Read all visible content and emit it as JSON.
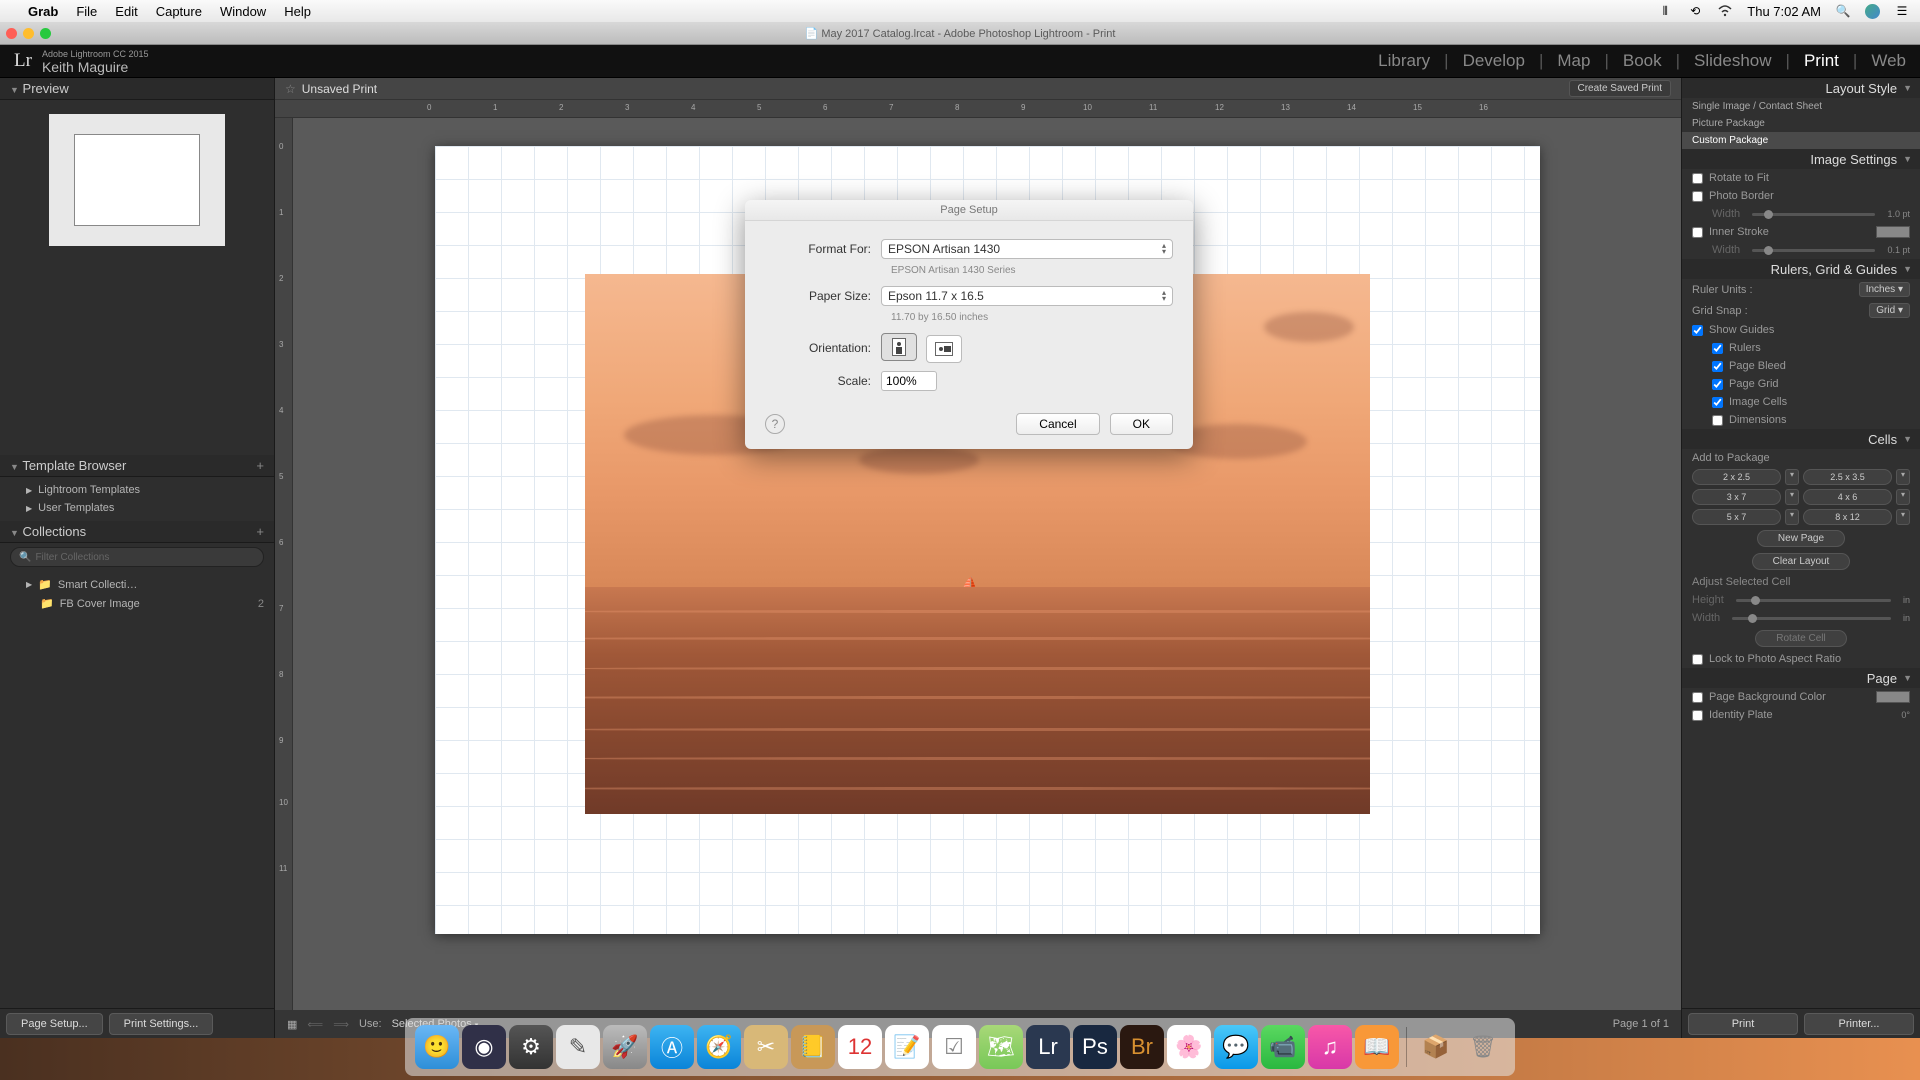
{
  "menubar": {
    "app": "Grab",
    "items": [
      "File",
      "Edit",
      "Capture",
      "Window",
      "Help"
    ],
    "clock": "Thu 7:02 AM"
  },
  "titlebar": "May 2017 Catalog.lrcat - Adobe Photoshop Lightroom - Print",
  "brand": {
    "version": "Adobe Lightroom CC 2015",
    "user": "Keith Maguire",
    "logo": "Lr"
  },
  "modules": [
    "Library",
    "Develop",
    "Map",
    "Book",
    "Slideshow",
    "Print",
    "Web"
  ],
  "modules_active": "Print",
  "left": {
    "preview": "Preview",
    "template_browser": "Template Browser",
    "templates": [
      "Lightroom Templates",
      "User Templates"
    ],
    "collections": "Collections",
    "filter_placeholder": "Filter Collections",
    "smart": "Smart Collecti…",
    "fb": "FB Cover Image",
    "fb_count": "2"
  },
  "center": {
    "header": "Unsaved Print",
    "save": "Create Saved Print",
    "use": "Use:",
    "use_value": "Selected Photos",
    "page_info": "Page 1 of 1"
  },
  "bottom": {
    "page_setup": "Page Setup...",
    "print_settings": "Print Settings..."
  },
  "right": {
    "layout_style": "Layout Style",
    "styles": [
      "Single Image / Contact Sheet",
      "Picture Package",
      "Custom Package"
    ],
    "style_active": 2,
    "image_settings": "Image Settings",
    "rotate_fit": "Rotate to Fit",
    "photo_border": "Photo Border",
    "width": "Width",
    "width_val": "1.0 pt",
    "inner_stroke": "Inner Stroke",
    "stroke_val": "0.1 pt",
    "rulers_hdr": "Rulers, Grid & Guides",
    "ruler_units": "Ruler Units :",
    "ruler_units_val": "Inches",
    "grid_snap": "Grid Snap :",
    "grid_snap_val": "Grid",
    "show_guides": "Show Guides",
    "guides": [
      "Rulers",
      "Page Bleed",
      "Page Grid",
      "Image Cells",
      "Dimensions"
    ],
    "guides_checked": [
      true,
      true,
      true,
      true,
      false
    ],
    "cells_hdr": "Cells",
    "add_package": "Add to Package",
    "cell_sizes": [
      [
        "2 x 2.5",
        "2.5 x 3.5"
      ],
      [
        "3 x 7",
        "4 x 6"
      ],
      [
        "5 x 7",
        "8 x 12"
      ]
    ],
    "new_page": "New Page",
    "clear_layout": "Clear Layout",
    "adjust": "Adjust Selected Cell",
    "height": "Height",
    "width2": "Width",
    "unit_in": "in",
    "rotate_cell": "Rotate Cell",
    "lock_aspect": "Lock to Photo Aspect Ratio",
    "page_hdr": "Page",
    "page_bg": "Page Background Color",
    "identity": "Identity Plate",
    "identity_angle": "0°",
    "print_btn": "Print",
    "printer_btn": "Printer..."
  },
  "dialog": {
    "title": "Page Setup",
    "format_for": "Format For:",
    "format_val": "EPSON Artisan 1430",
    "format_sub": "EPSON Artisan 1430 Series",
    "paper_size": "Paper Size:",
    "paper_val": "Epson 11.7 x 16.5",
    "paper_sub": "11.70 by 16.50 inches",
    "orientation": "Orientation:",
    "scale": "Scale:",
    "scale_val": "100%",
    "cancel": "Cancel",
    "ok": "OK"
  }
}
